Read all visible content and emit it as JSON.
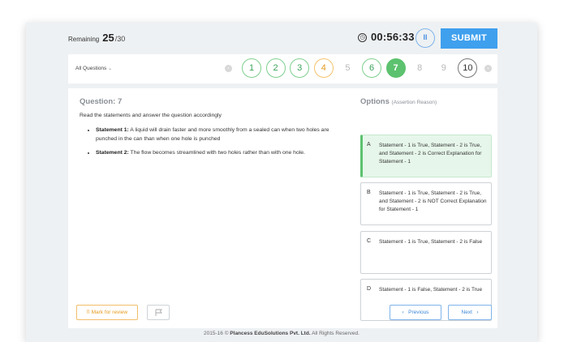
{
  "header": {
    "remaining_label": "Remaining",
    "remaining_count": "25",
    "remaining_total": "/30",
    "timer": "00:56:33",
    "pause_glyph": "II",
    "submit_label": "SUBMIT"
  },
  "nav": {
    "all_questions_label": "All Questions",
    "prev_arrow": "‹",
    "next_arrow": "›",
    "questions": [
      {
        "num": "1",
        "state": "answered"
      },
      {
        "num": "2",
        "state": "answered"
      },
      {
        "num": "3",
        "state": "answered"
      },
      {
        "num": "4",
        "state": "review"
      },
      {
        "num": "5",
        "state": "unseen"
      },
      {
        "num": "6",
        "state": "answered"
      },
      {
        "num": "7",
        "state": "current"
      },
      {
        "num": "8",
        "state": "unseen"
      },
      {
        "num": "9",
        "state": "unseen"
      },
      {
        "num": "10",
        "state": "visited"
      }
    ]
  },
  "question": {
    "title": "Question: 7",
    "instruction": "Read the statements and answer the question accordingly",
    "statements": [
      {
        "label": "Statement 1:",
        "text": " A liquid will drain faster and more smoothly from a sealed can when two holes are punched in the can than when one hole is punched"
      },
      {
        "label": "Statement 2:",
        "text": " The flow becomes streamlined with two holes rather than with one hole."
      }
    ]
  },
  "options": {
    "heading": "Options",
    "subheading": "(Assertion Reason)",
    "items": [
      {
        "letter": "A",
        "text": "Statement - 1 is True, Statement - 2 is True, and Statement - 2 is Correct Explanation for Statement - 1",
        "selected": true
      },
      {
        "letter": "B",
        "text": "Statement - 1 is True, Statement - 2 is True, and Statement - 2 is NOT Correct Explanation for Statement - 1",
        "selected": false
      },
      {
        "letter": "C",
        "text": "Statement - 1 is True, Statement - 2 is False",
        "selected": false
      },
      {
        "letter": "D",
        "text": "Statement - 1 is False, Statement - 2 is True",
        "selected": false
      }
    ]
  },
  "actions": {
    "mark_review_label": "Mark for review",
    "previous_label": "Previous",
    "next_label": "Next"
  },
  "footer": {
    "prefix": "2015-16 © ",
    "company": "Plancess EduSolutions Pvt. Ltd.",
    "suffix": " All Rights Reserved."
  },
  "colors": {
    "accent_blue": "#3fa0ee",
    "answered_green": "#5cc26f",
    "review_orange": "#e69a1c"
  }
}
